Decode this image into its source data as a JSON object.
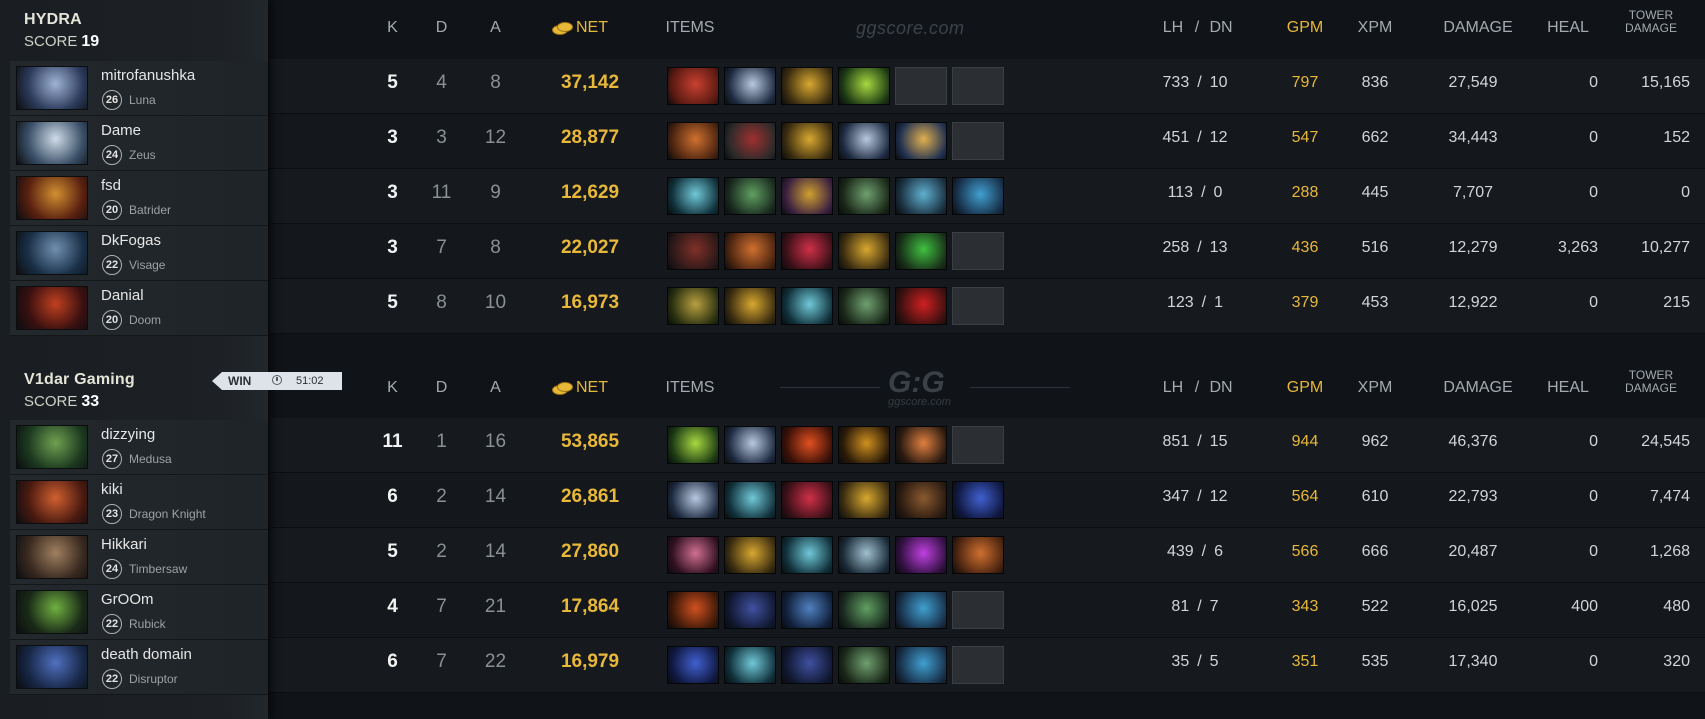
{
  "site_watermark": "ggscore.com",
  "logo_text": "G:G",
  "logo_sub": "ggscore.com",
  "headers": {
    "k": "K",
    "d": "D",
    "a": "A",
    "net": "NET",
    "items": "ITEMS",
    "lh": "LH",
    "slash": "/",
    "dn": "DN",
    "gpm": "GPM",
    "xpm": "XPM",
    "damage": "DAMAGE",
    "heal": "HEAL",
    "tower_1": "TOWER",
    "tower_2": "DAMAGE"
  },
  "score_label": "SCORE",
  "result": {
    "label": "WIN",
    "duration": "51:02"
  },
  "colors": {
    "gold": "#e8b83a",
    "background": "#101418",
    "sidebar": "#1d2125"
  },
  "teams": [
    {
      "name": "HYDRA",
      "score": "19",
      "players": [
        {
          "name": "mitrofanushka",
          "level": "26",
          "hero": "Luna",
          "k": "5",
          "d": "4",
          "a": "8",
          "net": "37,142",
          "lh": "733",
          "dn": "10",
          "gpm": "797",
          "xpm": "836",
          "damage": "27,549",
          "heal": "0",
          "tower": "15,165",
          "portrait": [
            "#2c3a5a",
            "#9fb3d6"
          ],
          "items": [
            [
              "#5a1a12",
              "#c84030"
            ],
            [
              "#1d2a40",
              "#b8c8e0"
            ],
            [
              "#3a2c10",
              "#d8a830"
            ],
            [
              "#1c3a14",
              "#a8d840"
            ],
            null,
            null
          ]
        },
        {
          "name": "Dame",
          "level": "24",
          "hero": "Zeus",
          "k": "3",
          "d": "3",
          "a": "12",
          "net": "28,877",
          "lh": "451",
          "dn": "12",
          "gpm": "547",
          "xpm": "662",
          "damage": "34,443",
          "heal": "0",
          "tower": "152",
          "portrait": [
            "#3a5068",
            "#d0dce8"
          ],
          "items": [
            [
              "#4a2410",
              "#d07030"
            ],
            [
              "#2a2a2a",
              "#a03030"
            ],
            [
              "#3a2c10",
              "#d8a830"
            ],
            [
              "#1d2a40",
              "#b8c8e0"
            ],
            [
              "#203050",
              "#e0b050"
            ],
            null
          ]
        },
        {
          "name": "fsd",
          "level": "20",
          "hero": "Batrider",
          "k": "3",
          "d": "11",
          "a": "9",
          "net": "12,629",
          "lh": "113",
          "dn": "0",
          "gpm": "288",
          "xpm": "445",
          "damage": "7,707",
          "heal": "0",
          "tower": "0",
          "portrait": [
            "#5a2010",
            "#d09030"
          ],
          "items": [
            [
              "#10303a",
              "#70c8d8"
            ],
            [
              "#1a2a20",
              "#60a060"
            ],
            [
              "#3a2040",
              "#d0a030"
            ],
            [
              "#1a2818",
              "#70a070"
            ],
            [
              "#1a3040",
              "#60b0d0"
            ],
            [
              "#18304a",
              "#40a0d0"
            ]
          ]
        },
        {
          "name": "DkFogas",
          "level": "22",
          "hero": "Visage",
          "k": "3",
          "d": "7",
          "a": "8",
          "net": "22,027",
          "lh": "258",
          "dn": "13",
          "gpm": "436",
          "xpm": "516",
          "damage": "12,279",
          "heal": "3,263",
          "tower": "10,277",
          "portrait": [
            "#1a3048",
            "#7090b0"
          ],
          "items": [
            [
              "#2a1818",
              "#803028"
            ],
            [
              "#4a2410",
              "#d07030"
            ],
            [
              "#3a1018",
              "#d03048"
            ],
            [
              "#3a2c10",
              "#d8a830"
            ],
            [
              "#183018",
              "#40c040"
            ],
            null
          ]
        },
        {
          "name": "Danial",
          "level": "20",
          "hero": "Doom",
          "k": "5",
          "d": "8",
          "a": "10",
          "net": "16,973",
          "lh": "123",
          "dn": "1",
          "gpm": "379",
          "xpm": "453",
          "damage": "12,922",
          "heal": "0",
          "tower": "215",
          "portrait": [
            "#3a1010",
            "#c04020"
          ],
          "items": [
            [
              "#2a3010",
              "#b8a040"
            ],
            [
              "#3a2c10",
              "#d8a830"
            ],
            [
              "#10303a",
              "#70c8d8"
            ],
            [
              "#1a2818",
              "#70a070"
            ],
            [
              "#3a1010",
              "#d02020"
            ],
            null
          ]
        }
      ]
    },
    {
      "name": "V1dar Gaming",
      "score": "33",
      "players": [
        {
          "name": "dizzying",
          "level": "27",
          "hero": "Medusa",
          "k": "11",
          "d": "1",
          "a": "16",
          "net": "53,865",
          "lh": "851",
          "dn": "15",
          "gpm": "944",
          "xpm": "962",
          "damage": "46,376",
          "heal": "0",
          "tower": "24,545",
          "portrait": [
            "#1c3a20",
            "#70a050"
          ],
          "items": [
            [
              "#1c3a14",
              "#a8d840"
            ],
            [
              "#1d2a40",
              "#b8c8e0"
            ],
            [
              "#3a1008",
              "#e05020"
            ],
            [
              "#2a1a08",
              "#d09020"
            ],
            [
              "#2a1a10",
              "#e08040"
            ],
            null
          ]
        },
        {
          "name": "kiki",
          "level": "23",
          "hero": "Dragon Knight",
          "k": "6",
          "d": "2",
          "a": "14",
          "net": "26,861",
          "lh": "347",
          "dn": "12",
          "gpm": "564",
          "xpm": "610",
          "damage": "22,793",
          "heal": "0",
          "tower": "7,474",
          "portrait": [
            "#4a1a10",
            "#d06030"
          ],
          "items": [
            [
              "#1d2a40",
              "#b8c8e0"
            ],
            [
              "#10303a",
              "#70c8d8"
            ],
            [
              "#3a1018",
              "#d03048"
            ],
            [
              "#3a2c10",
              "#d8a830"
            ],
            [
              "#2a1a10",
              "#8a5a30"
            ],
            [
              "#101840",
              "#4060d0"
            ]
          ]
        },
        {
          "name": "Hikkari",
          "level": "24",
          "hero": "Timbersaw",
          "k": "5",
          "d": "2",
          "a": "14",
          "net": "27,860",
          "lh": "439",
          "dn": "6",
          "gpm": "566",
          "xpm": "666",
          "damage": "20,487",
          "heal": "0",
          "tower": "1,268",
          "portrait": [
            "#3a2a20",
            "#a08060"
          ],
          "items": [
            [
              "#301020",
              "#d07090"
            ],
            [
              "#3a2c10",
              "#d8a830"
            ],
            [
              "#10303a",
              "#70c8d8"
            ],
            [
              "#1a2a38",
              "#a0c0d0"
            ],
            [
              "#301040",
              "#c040e0"
            ],
            [
              "#4a2410",
              "#d07030"
            ]
          ]
        },
        {
          "name": "GrOOm",
          "level": "22",
          "hero": "Rubick",
          "k": "4",
          "d": "7",
          "a": "21",
          "net": "17,864",
          "lh": "81",
          "dn": "7",
          "gpm": "343",
          "xpm": "522",
          "damage": "16,025",
          "heal": "400",
          "tower": "480",
          "portrait": [
            "#1a2a18",
            "#70b040"
          ],
          "items": [
            [
              "#3a1808",
              "#d05020"
            ],
            [
              "#101830",
              "#4050a0"
            ],
            [
              "#10203a",
              "#5080c0"
            ],
            [
              "#1a2a20",
              "#60a060"
            ],
            [
              "#18304a",
              "#40a0d0"
            ],
            null
          ]
        },
        {
          "name": "death domain",
          "level": "22",
          "hero": "Disruptor",
          "k": "6",
          "d": "7",
          "a": "22",
          "net": "16,979",
          "lh": "35",
          "dn": "5",
          "gpm": "351",
          "xpm": "535",
          "damage": "17,340",
          "heal": "0",
          "tower": "320",
          "portrait": [
            "#182848",
            "#5070c0"
          ],
          "items": [
            [
              "#101840",
              "#4060d0"
            ],
            [
              "#10303a",
              "#70c8d8"
            ],
            [
              "#101830",
              "#4050a0"
            ],
            [
              "#1a2818",
              "#70a070"
            ],
            [
              "#18304a",
              "#40a0d0"
            ],
            null
          ]
        }
      ]
    }
  ]
}
